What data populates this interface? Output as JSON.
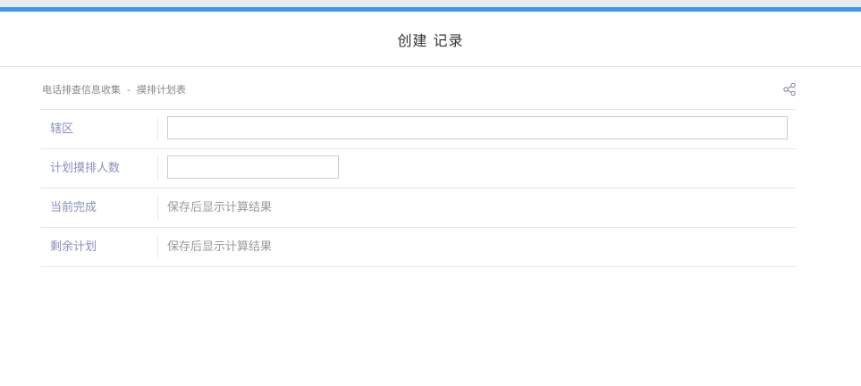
{
  "header": {
    "title": "创建 记录"
  },
  "breadcrumb": {
    "app": "电话排查信息收集",
    "separator": "-",
    "form": "摸排计划表"
  },
  "icons": {
    "share": "share-icon"
  },
  "fields": [
    {
      "label": "辖区",
      "type": "input",
      "value": ""
    },
    {
      "label": "计划摸排人数",
      "type": "input",
      "value": ""
    },
    {
      "label": "当前完成",
      "type": "computed",
      "value": "保存后显示计算结果"
    },
    {
      "label": "剩余计划",
      "type": "computed",
      "value": "保存后显示计算结果"
    }
  ],
  "colors": {
    "accent": "#3f97e6",
    "label": "#8a8fbf",
    "muted": "#999999"
  }
}
